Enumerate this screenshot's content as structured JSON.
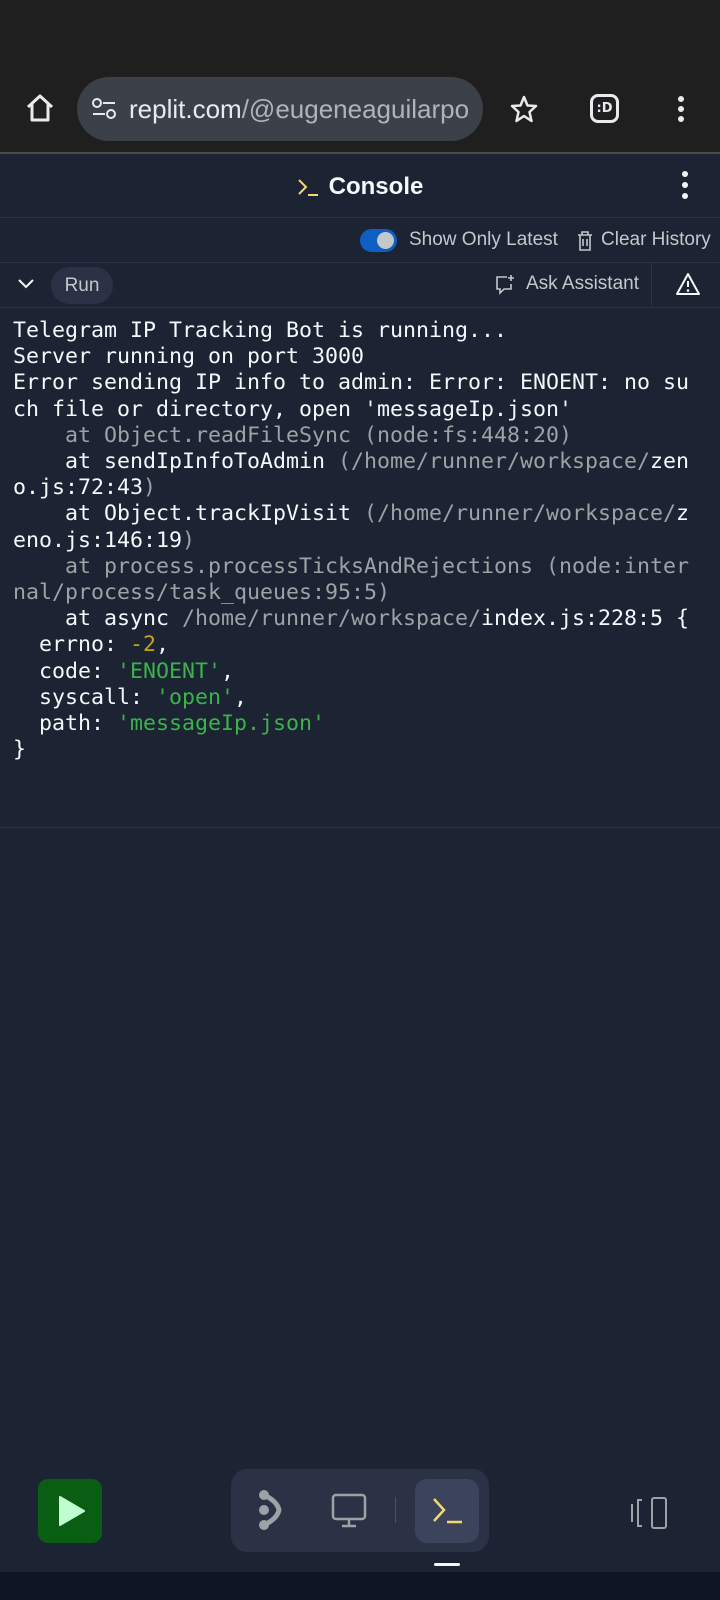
{
  "browser": {
    "url_host": "replit.com",
    "url_path": "/@eugeneaguilarpo",
    "icons": [
      "home-icon",
      "site-settings-icon",
      "star-icon",
      "extension-icon",
      "more-vert-icon"
    ]
  },
  "header": {
    "title": "Console",
    "icon": "terminal-icon"
  },
  "toolbar": {
    "show_only_latest_label": "Show Only Latest",
    "show_only_latest_on": true,
    "clear_history_label": "Clear History"
  },
  "runbar": {
    "run_label": "Run",
    "ask_assistant_label": "Ask Assistant"
  },
  "console": {
    "lines": [
      [
        {
          "t": "Telegram IP Tracking Bot is running...",
          "c": "w"
        }
      ],
      [
        {
          "t": "Server running on port 3000",
          "c": "w"
        }
      ],
      [
        {
          "t": "Error sending IP info to admin: Error: ENOENT: no su",
          "c": "w"
        }
      ],
      [
        {
          "t": "ch file or directory, open 'messageIp.json'",
          "c": "w"
        }
      ],
      [
        {
          "t": "    at Object.readFileSync (node:fs:448:20)",
          "c": "g"
        }
      ],
      [
        {
          "t": "    at sendIpInfoToAdmin ",
          "c": "w"
        },
        {
          "t": "(/home/runner/workspace/",
          "c": "g"
        },
        {
          "t": "zen",
          "c": "w"
        }
      ],
      [
        {
          "t": "o.js:72:43",
          "c": "w"
        },
        {
          "t": ")",
          "c": "g"
        }
      ],
      [
        {
          "t": "    at Object.trackIpVisit ",
          "c": "w"
        },
        {
          "t": "(/home/runner/workspace/",
          "c": "g"
        },
        {
          "t": "z",
          "c": "w"
        }
      ],
      [
        {
          "t": "eno.js:146:19",
          "c": "w"
        },
        {
          "t": ")",
          "c": "g"
        }
      ],
      [
        {
          "t": "    at process.processTicksAndRejections (node:inter",
          "c": "g"
        }
      ],
      [
        {
          "t": "nal/process/task_queues:95:5)",
          "c": "g"
        }
      ],
      [
        {
          "t": "    at async ",
          "c": "w"
        },
        {
          "t": "/home/runner/workspace/",
          "c": "g"
        },
        {
          "t": "index.js:228:5 {",
          "c": "w"
        }
      ],
      [
        {
          "t": "  errno: ",
          "c": "w"
        },
        {
          "t": "-2",
          "c": "y"
        },
        {
          "t": ",",
          "c": "w"
        }
      ],
      [
        {
          "t": "  code: ",
          "c": "w"
        },
        {
          "t": "'ENOENT'",
          "c": "s"
        },
        {
          "t": ",",
          "c": "w"
        }
      ],
      [
        {
          "t": "  syscall: ",
          "c": "w"
        },
        {
          "t": "'open'",
          "c": "s"
        },
        {
          "t": ",",
          "c": "w"
        }
      ],
      [
        {
          "t": "  path: ",
          "c": "w"
        },
        {
          "t": "'messageIp.json'",
          "c": "s"
        }
      ],
      [
        {
          "t": "}",
          "c": "w"
        }
      ]
    ]
  },
  "bottom_nav": {
    "items": [
      "run-icon",
      "git-icon",
      "webview-icon",
      "console-icon",
      "layout-icon"
    ],
    "active": "console-icon"
  },
  "colors": {
    "background": "#1c2333",
    "run_green": "#0a5e14",
    "accent_yellow": "#f5d76e",
    "string_green": "#3ab44a",
    "toggle_blue": "#0f5ec4"
  }
}
